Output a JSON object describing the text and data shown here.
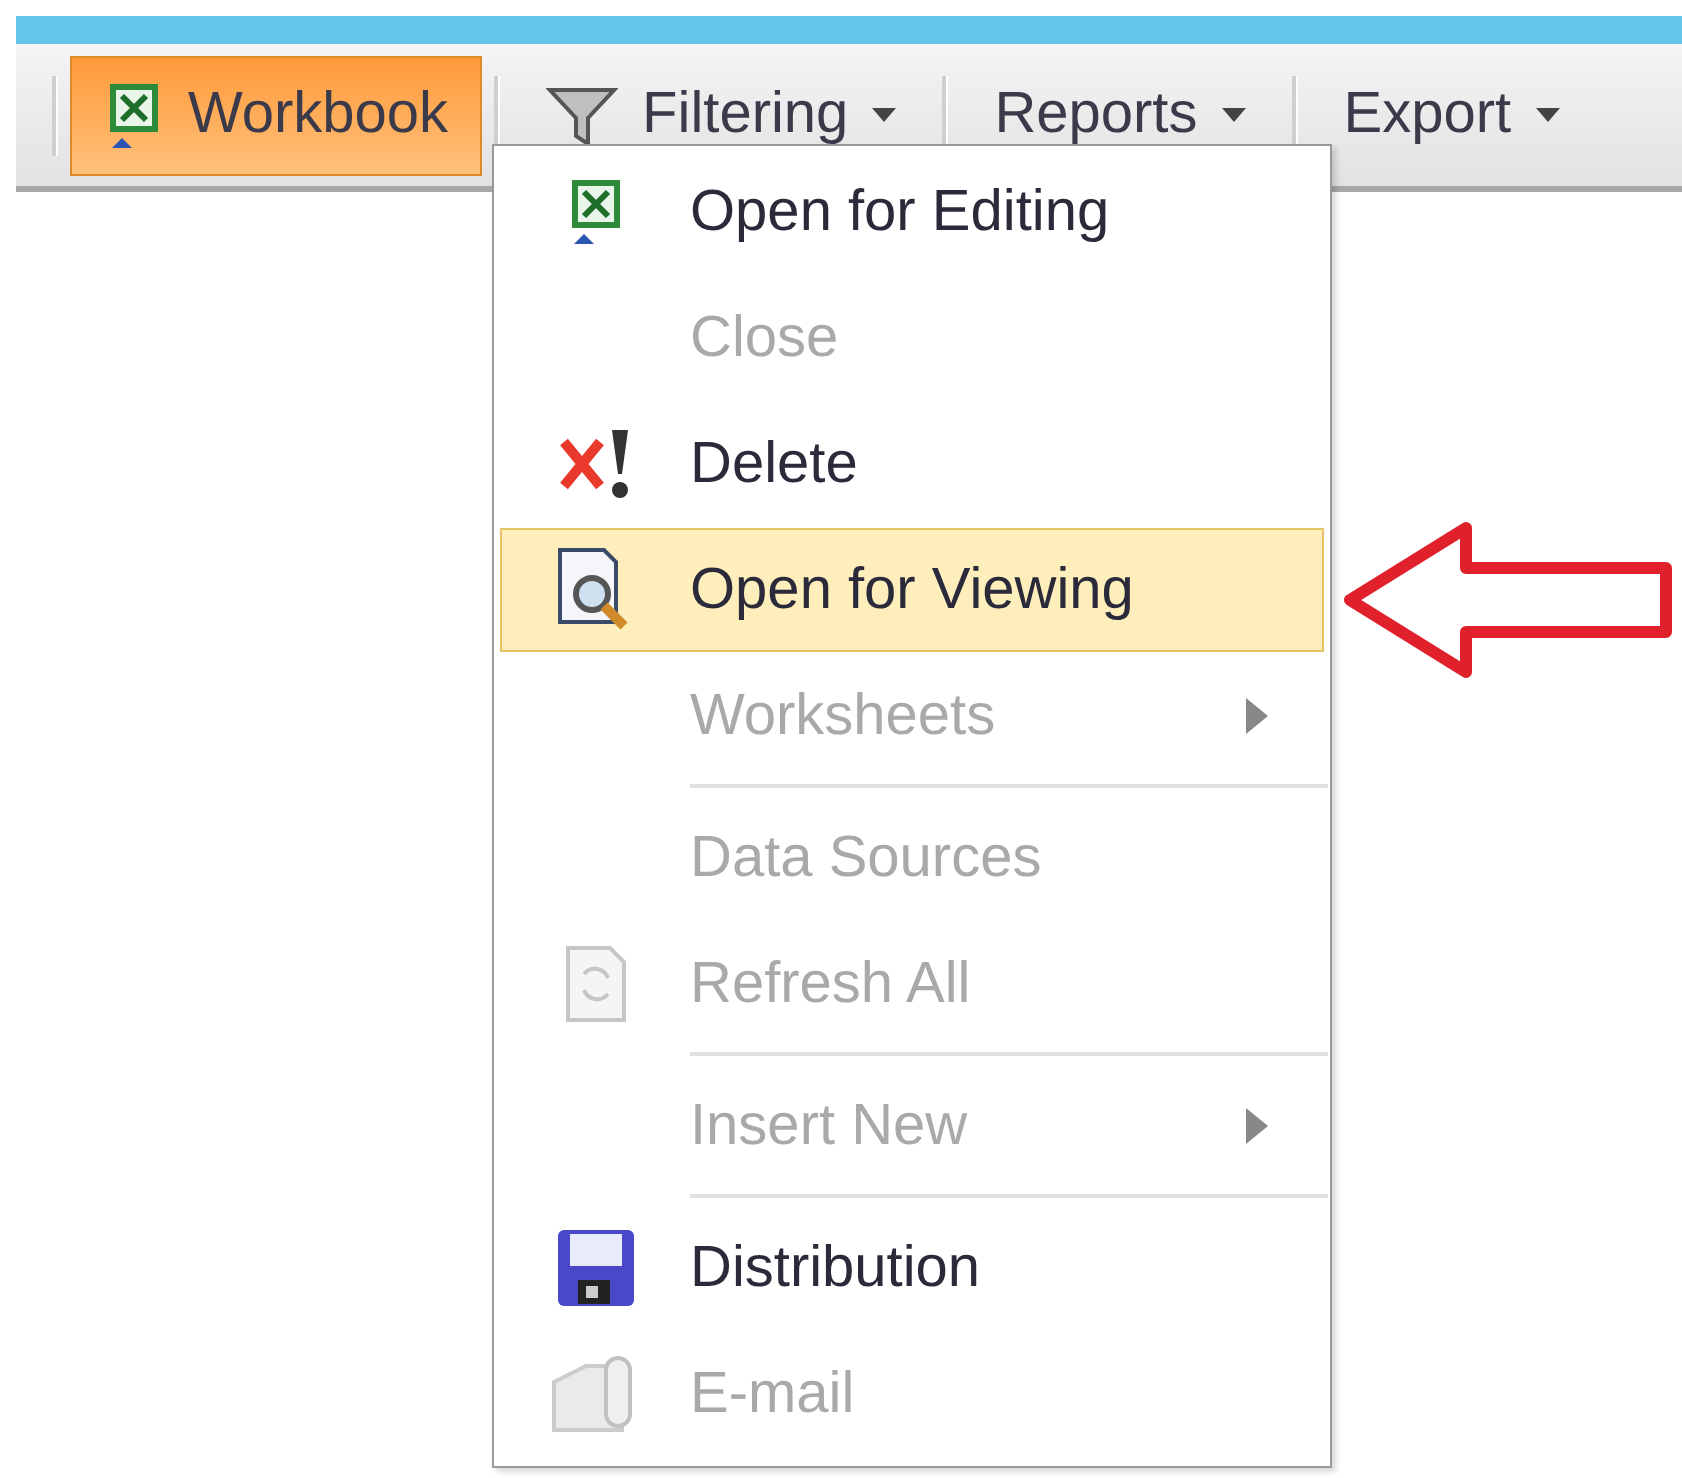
{
  "toolbar": {
    "buttons": [
      {
        "label": "Workbook",
        "selected": true,
        "dropdown": false
      },
      {
        "label": "Filtering",
        "selected": false,
        "dropdown": true
      },
      {
        "label": "Reports",
        "selected": false,
        "dropdown": true
      },
      {
        "label": "Export",
        "selected": false,
        "dropdown": true
      }
    ]
  },
  "menu": {
    "items": [
      {
        "label": "Open for Editing",
        "disabled": false,
        "selected": false,
        "submenu": false,
        "separator_after": false
      },
      {
        "label": "Close",
        "disabled": true,
        "selected": false,
        "submenu": false,
        "separator_after": false
      },
      {
        "label": "Delete",
        "disabled": false,
        "selected": false,
        "submenu": false,
        "separator_after": false
      },
      {
        "label": "Open for Viewing",
        "disabled": false,
        "selected": true,
        "submenu": false,
        "separator_after": false
      },
      {
        "label": "Worksheets",
        "disabled": true,
        "selected": false,
        "submenu": true,
        "separator_after": true
      },
      {
        "label": "Data Sources",
        "disabled": true,
        "selected": false,
        "submenu": false,
        "separator_after": false
      },
      {
        "label": "Refresh All",
        "disabled": true,
        "selected": false,
        "submenu": false,
        "separator_after": true
      },
      {
        "label": "Insert New",
        "disabled": true,
        "selected": false,
        "submenu": true,
        "separator_after": true
      },
      {
        "label": "Distribution",
        "disabled": false,
        "selected": false,
        "submenu": false,
        "separator_after": false
      },
      {
        "label": "E-mail",
        "disabled": true,
        "selected": false,
        "submenu": false,
        "separator_after": false
      }
    ]
  }
}
